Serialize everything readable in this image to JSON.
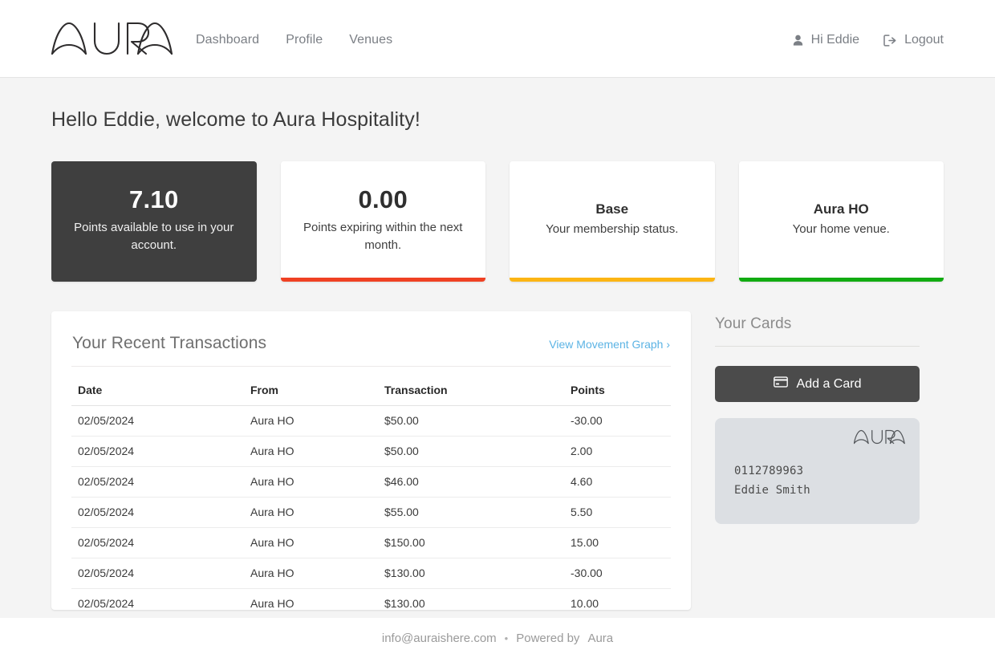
{
  "header": {
    "brand": "AURA",
    "brand_icon": "aura-wordmark-logo",
    "nav": [
      {
        "label": "Dashboard"
      },
      {
        "label": "Profile"
      },
      {
        "label": "Venues"
      }
    ],
    "greeting": {
      "label": "Hi Eddie",
      "icon": "user-icon"
    },
    "logout": {
      "label": "Logout",
      "icon": "sign-out-icon"
    }
  },
  "main": {
    "welcome": "Hello Eddie, welcome to Aura Hospitality!",
    "stat_cards": [
      {
        "value": "7.10",
        "title": "",
        "description": "Points available to use in your account.",
        "accent": "",
        "theme": "dark"
      },
      {
        "value": "0.00",
        "title": "",
        "description": "Points expiring within the next month.",
        "accent": "#ef4123",
        "theme": "light"
      },
      {
        "value": "",
        "title": "Base",
        "description": "Your membership status.",
        "accent": "#fcb514",
        "theme": "light"
      },
      {
        "value": "",
        "title": "Aura HO",
        "description": "Your home venue.",
        "accent": "#11ab11",
        "theme": "light"
      }
    ],
    "transactions": {
      "title": "Your Recent Transactions",
      "link": "View Movement Graph ›",
      "columns": [
        "Date",
        "From",
        "Transaction",
        "Points"
      ],
      "rows": [
        [
          "02/05/2024",
          "Aura HO",
          "$50.00",
          "-30.00"
        ],
        [
          "02/05/2024",
          "Aura HO",
          "$50.00",
          "2.00"
        ],
        [
          "02/05/2024",
          "Aura HO",
          "$46.00",
          "4.60"
        ],
        [
          "02/05/2024",
          "Aura HO",
          "$55.00",
          "5.50"
        ],
        [
          "02/05/2024",
          "Aura HO",
          "$150.00",
          "15.00"
        ],
        [
          "02/05/2024",
          "Aura HO",
          "$130.00",
          "-30.00"
        ],
        [
          "02/05/2024",
          "Aura HO",
          "$130.00",
          "10.00"
        ]
      ]
    },
    "cards": {
      "title": "Your Cards",
      "add_button": {
        "label": "Add a Card",
        "icon": "credit-card-icon"
      },
      "loyalty_card": {
        "brand": "AURA",
        "number": "0112789963",
        "holder": "Eddie Smith",
        "background": "#dcdfe3"
      }
    }
  },
  "footer": {
    "email": "info@auraishere.com",
    "separator": "•",
    "powered_by": "Powered by",
    "powered_by_brand": "Aura"
  }
}
